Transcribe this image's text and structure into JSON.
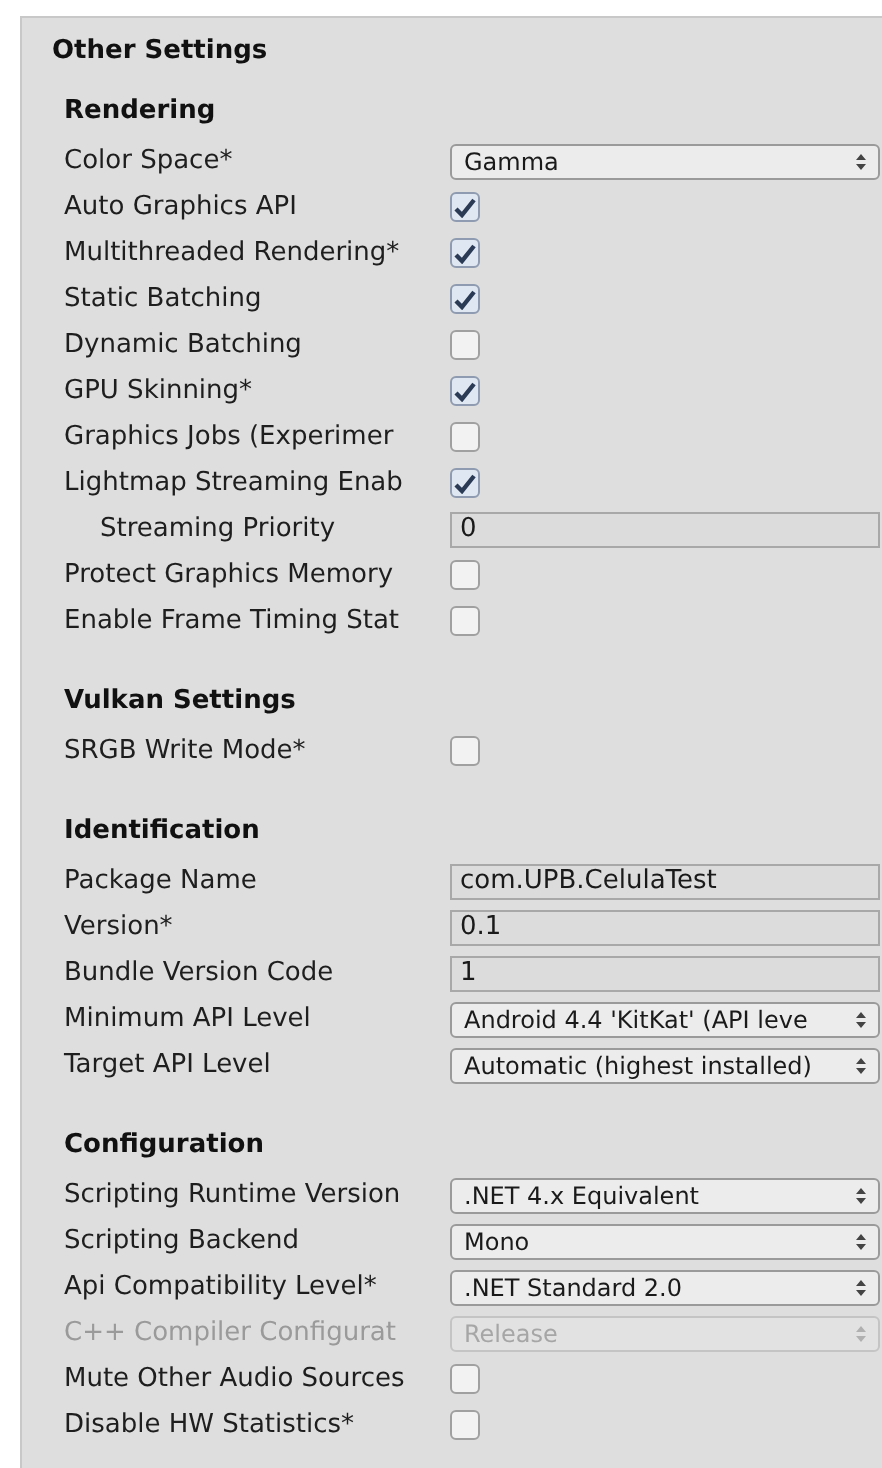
{
  "panel": {
    "title": "Other Settings"
  },
  "sections": [
    {
      "title": "Rendering",
      "rows": [
        {
          "kind": "dropdown",
          "label": "Color Space*",
          "value": "Gamma",
          "disabled": false
        },
        {
          "kind": "checkbox",
          "label": "Auto Graphics API",
          "checked": true
        },
        {
          "kind": "checkbox",
          "label": "Multithreaded Rendering*",
          "checked": true
        },
        {
          "kind": "checkbox",
          "label": "Static Batching",
          "checked": true
        },
        {
          "kind": "checkbox",
          "label": "Dynamic Batching",
          "checked": false
        },
        {
          "kind": "checkbox",
          "label": "GPU Skinning*",
          "checked": true
        },
        {
          "kind": "checkbox",
          "label": "Graphics Jobs (Experimer",
          "checked": false
        },
        {
          "kind": "checkbox",
          "label": "Lightmap Streaming Enab",
          "checked": true,
          "children": [
            {
              "kind": "text",
              "label": "Streaming Priority",
              "value": "0"
            }
          ]
        },
        {
          "kind": "checkbox",
          "label": "Protect Graphics Memory",
          "checked": false
        },
        {
          "kind": "checkbox",
          "label": "Enable Frame Timing Stat",
          "checked": false
        }
      ]
    },
    {
      "title": "Vulkan Settings",
      "rows": [
        {
          "kind": "checkbox",
          "label": "SRGB Write Mode*",
          "checked": false
        }
      ]
    },
    {
      "title": "Identification",
      "rows": [
        {
          "kind": "text",
          "label": "Package Name",
          "value": "com.UPB.CelulaTest"
        },
        {
          "kind": "text",
          "label": "Version*",
          "value": "0.1"
        },
        {
          "kind": "text",
          "label": "Bundle Version Code",
          "value": "1"
        },
        {
          "kind": "dropdown",
          "label": "Minimum API Level",
          "value": "Android 4.4 'KitKat' (API leve",
          "disabled": false
        },
        {
          "kind": "dropdown",
          "label": "Target API Level",
          "value": "Automatic (highest installed)",
          "disabled": false
        }
      ]
    },
    {
      "title": "Configuration",
      "rows": [
        {
          "kind": "dropdown",
          "label": "Scripting Runtime Version",
          "value": ".NET 4.x Equivalent",
          "disabled": false
        },
        {
          "kind": "dropdown",
          "label": "Scripting Backend",
          "value": "Mono",
          "disabled": false
        },
        {
          "kind": "dropdown",
          "label": "Api Compatibility Level*",
          "value": ".NET Standard 2.0",
          "disabled": false
        },
        {
          "kind": "dropdown",
          "label": "C++ Compiler Configurat",
          "value": "Release",
          "disabled": true
        },
        {
          "kind": "checkbox",
          "label": "Mute Other Audio Sources",
          "checked": false
        },
        {
          "kind": "checkbox",
          "label": "Disable HW Statistics*",
          "checked": false
        }
      ]
    }
  ]
}
